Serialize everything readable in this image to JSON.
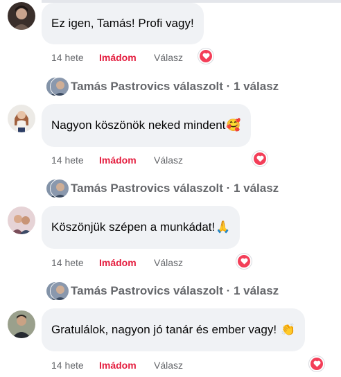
{
  "comments": [
    {
      "text": "Ez igen, Tamás! Profi vagy!",
      "emoji": "",
      "time": "14 hete",
      "like_label": "Imádom",
      "reply_label": "Válasz",
      "reaction": "love-heart"
    },
    {
      "text": "Nagyon köszönök neked mindent",
      "emoji": "🥰",
      "time": "14 hete",
      "like_label": "Imádom",
      "reply_label": "Válasz",
      "reaction": "love-heart"
    },
    {
      "text": "Köszönjük szépen a munkádat!",
      "emoji": "🙏",
      "time": "14 hete",
      "like_label": "Imádom",
      "reply_label": "Válasz",
      "reaction": "love-heart"
    },
    {
      "text": "Gratulálok, nagyon jó tanár és ember vagy!",
      "emoji": "👏",
      "time": "14 hete",
      "like_label": "Imádom",
      "reply_label": "Válasz",
      "reaction": "love-heart"
    }
  ],
  "replies": [
    {
      "text": "Tamás Pastrovics válaszolt · 1 válasz"
    },
    {
      "text": "Tamás Pastrovics válaszolt · 1 válasz"
    },
    {
      "text": "Tamás Pastrovics válaszolt · 1 válasz"
    }
  ],
  "colors": {
    "like": "#e41e3f",
    "muted": "#65676b",
    "bubble": "#f0f2f5",
    "heart": "#f33e58"
  }
}
